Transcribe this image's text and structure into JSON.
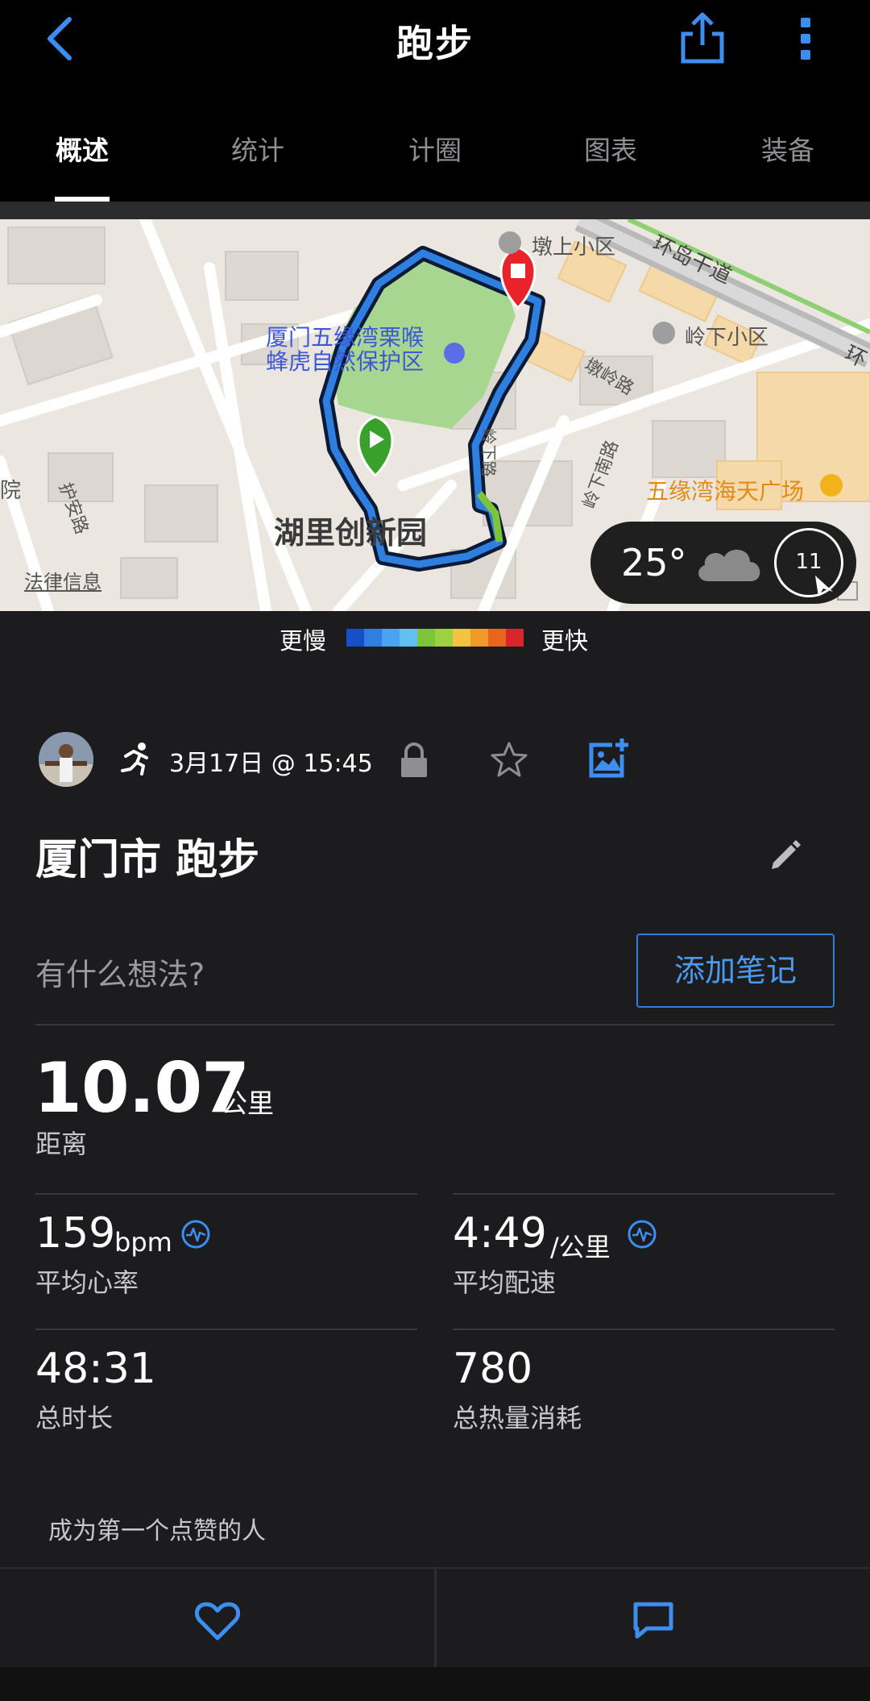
{
  "header": {
    "title": "跑步",
    "back_icon": "chevron-left-icon",
    "share_icon": "share-icon",
    "more_icon": "more-vertical-icon"
  },
  "tabs": [
    {
      "label": "概述",
      "active": true
    },
    {
      "label": "统计",
      "active": false
    },
    {
      "label": "计圈",
      "active": false
    },
    {
      "label": "图表",
      "active": false
    },
    {
      "label": "装备",
      "active": false
    }
  ],
  "map": {
    "labels": {
      "poi_park_line1": "厦门五缘湾栗喉",
      "poi_park_line2": "蜂虎自然保护区",
      "district": "湖里创新园",
      "area_dunshang": "墩上小区",
      "area_lingxia": "岭下小区",
      "road_huandao": "环岛干道",
      "road_huandao_cut": "环",
      "road_dunling": "墩岭路",
      "road_lingxia": "岭下路",
      "road_lingxia_south": "岭下南路",
      "road_hu_an": "护安路",
      "mall": "五缘湾海天广场",
      "left_edge_char": "院",
      "legal": "法律信息"
    },
    "weather": {
      "temperature": "25°",
      "condition_icon": "cloud-icon",
      "wind_speed": "11"
    }
  },
  "legend": {
    "slower": "更慢",
    "faster": "更快",
    "colors": [
      "#1550c8",
      "#2f7fe0",
      "#4aa3f0",
      "#62c0f0",
      "#7cc43a",
      "#9ed13f",
      "#f5c342",
      "#f09a2a",
      "#e8651e",
      "#d8262a"
    ]
  },
  "activity": {
    "type_icon": "running-icon",
    "datetime": "3月17日 @ 15:45",
    "privacy_icon": "lock-icon",
    "favorite_icon": "star-icon",
    "photo_icon": "add-photo-icon",
    "name": "厦门市 跑步",
    "edit_icon": "pencil-icon",
    "note_prompt": "有什么想法?",
    "add_note_label": "添加笔记"
  },
  "stats": {
    "distance": {
      "value": "10.07",
      "unit": "公里",
      "label": "距离"
    },
    "avg_hr": {
      "value": "159",
      "unit": "bpm",
      "label": "平均心率"
    },
    "avg_pace": {
      "value": "4:49",
      "unit": "/公里",
      "label": "平均配速"
    },
    "duration": {
      "value": "48:31",
      "label": "总时长"
    },
    "calories": {
      "value": "780",
      "label": "总热量消耗"
    }
  },
  "social": {
    "likes_prompt": "成为第一个点赞的人",
    "like_icon": "heart-icon",
    "comment_icon": "comment-icon"
  },
  "colors": {
    "accent": "#2f7fdc",
    "background": "#1c1c1e",
    "header_bg": "#000000"
  }
}
